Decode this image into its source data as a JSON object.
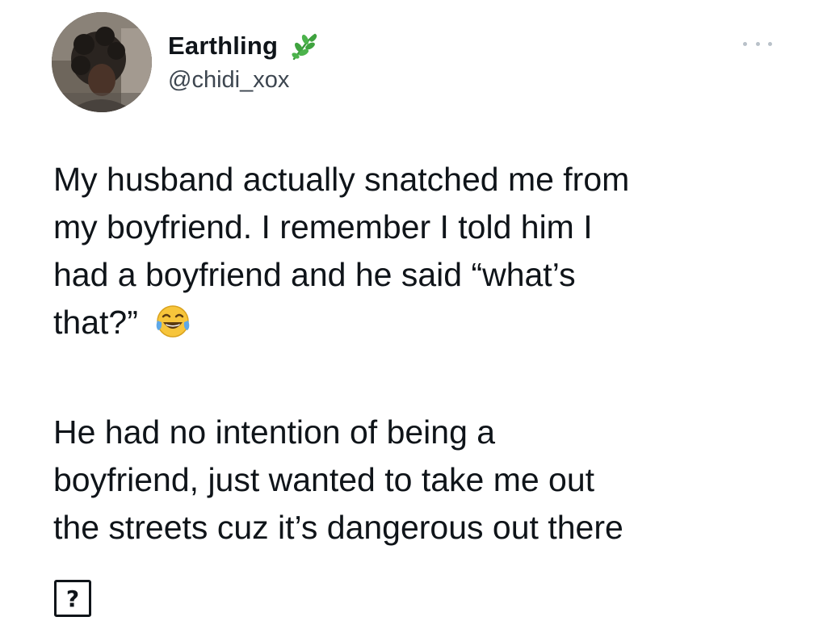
{
  "author": {
    "display_name": "Earthling",
    "handle": "@chidi_xox",
    "name_badge_icon": "herb-leaf-icon",
    "avatar_icon": "profile-photo-avatar"
  },
  "menu": {
    "more_icon": "more-options-icon"
  },
  "tweet": {
    "paragraph1": [
      "My husband actually snatched me from",
      "my boyfriend. I remember I told him I",
      "had a boyfriend and he said “what’s",
      "that?”"
    ],
    "paragraph1_trailing_icon": "tears-of-joy-emoji-icon",
    "paragraph2": [
      "He had no intention of being a",
      "boyfriend, just wanted to take me out",
      "the streets cuz it’s dangerous out there"
    ],
    "trailing_glyph": "?"
  },
  "colors": {
    "text": "#0f1419",
    "secondary_text": "#3d4650",
    "more_dots": "#b9c1c9",
    "leaf_green": "#3a9a3a",
    "emoji_yellow": "#f7c53b",
    "tears_blue": "#5ea8e8"
  }
}
